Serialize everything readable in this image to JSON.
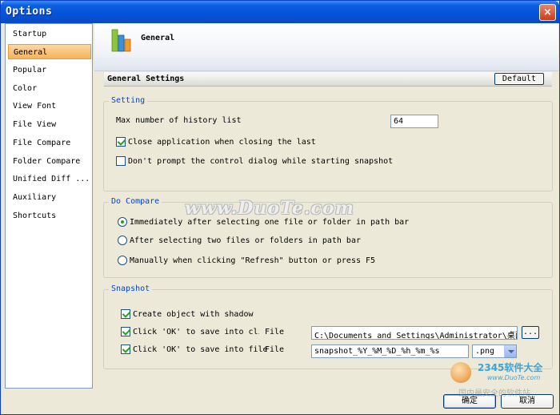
{
  "window": {
    "title": "Options",
    "close_label": "×"
  },
  "sidebar": {
    "items": [
      {
        "label": "Startup"
      },
      {
        "label": "General",
        "selected": true
      },
      {
        "label": "Popular"
      },
      {
        "label": "Color"
      },
      {
        "label": "View Font"
      },
      {
        "label": "File View"
      },
      {
        "label": "File Compare"
      },
      {
        "label": "Folder Compare"
      },
      {
        "label": "Unified Diff ..."
      },
      {
        "label": "Auxiliary"
      },
      {
        "label": "Shortcuts"
      }
    ]
  },
  "header": {
    "title": "General",
    "icon": "bar-chart-icon"
  },
  "settings_bar": {
    "label": "General Settings",
    "default_button": "Default"
  },
  "setting_group": {
    "title": "Setting",
    "history_label": "Max number of history list",
    "history_value": "64",
    "close_app_label": "Close application when closing the last tab",
    "close_app_checked": true,
    "no_prompt_label": "Don't prompt the control dialog while starting snapshot",
    "no_prompt_checked": false
  },
  "compare_group": {
    "title": "Do Compare",
    "options": [
      {
        "label": "Immediately after selecting one file or folder in path bar",
        "checked": true
      },
      {
        "label": "After selecting two files or folders in path bar",
        "checked": false
      },
      {
        "label": "Manually when clicking \"Refresh\" button or press F5",
        "checked": false
      }
    ]
  },
  "snapshot_group": {
    "title": "Snapshot",
    "shadow_label": "Create object with shadow",
    "shadow_checked": true,
    "clipboard_label": "Click 'OK' to save into clipboard",
    "clipboard_checked": true,
    "clipboard_file_label": "File",
    "clipboard_path": "C:\\Documents and Settings\\Administrator\\桌面",
    "browse_label": "...",
    "file_label": "Click 'OK' to save into file",
    "file_checked": true,
    "file_file_label": "File",
    "file_name": "snapshot_%Y_%M_%D_%h_%m_%s",
    "file_ext": ".png"
  },
  "footer": {
    "ok_label": "确定",
    "cancel_label": "取消"
  },
  "watermarks": {
    "duote": "www.DuoTe.com",
    "brand_num": "2345软件大全",
    "brand_url": "www.DuoTe.com",
    "brand_cn": "国内最安全的软件站"
  },
  "colors": {
    "title_bar": "#0553d8",
    "selection": "#f6b25c",
    "group_title": "#0046d5"
  }
}
